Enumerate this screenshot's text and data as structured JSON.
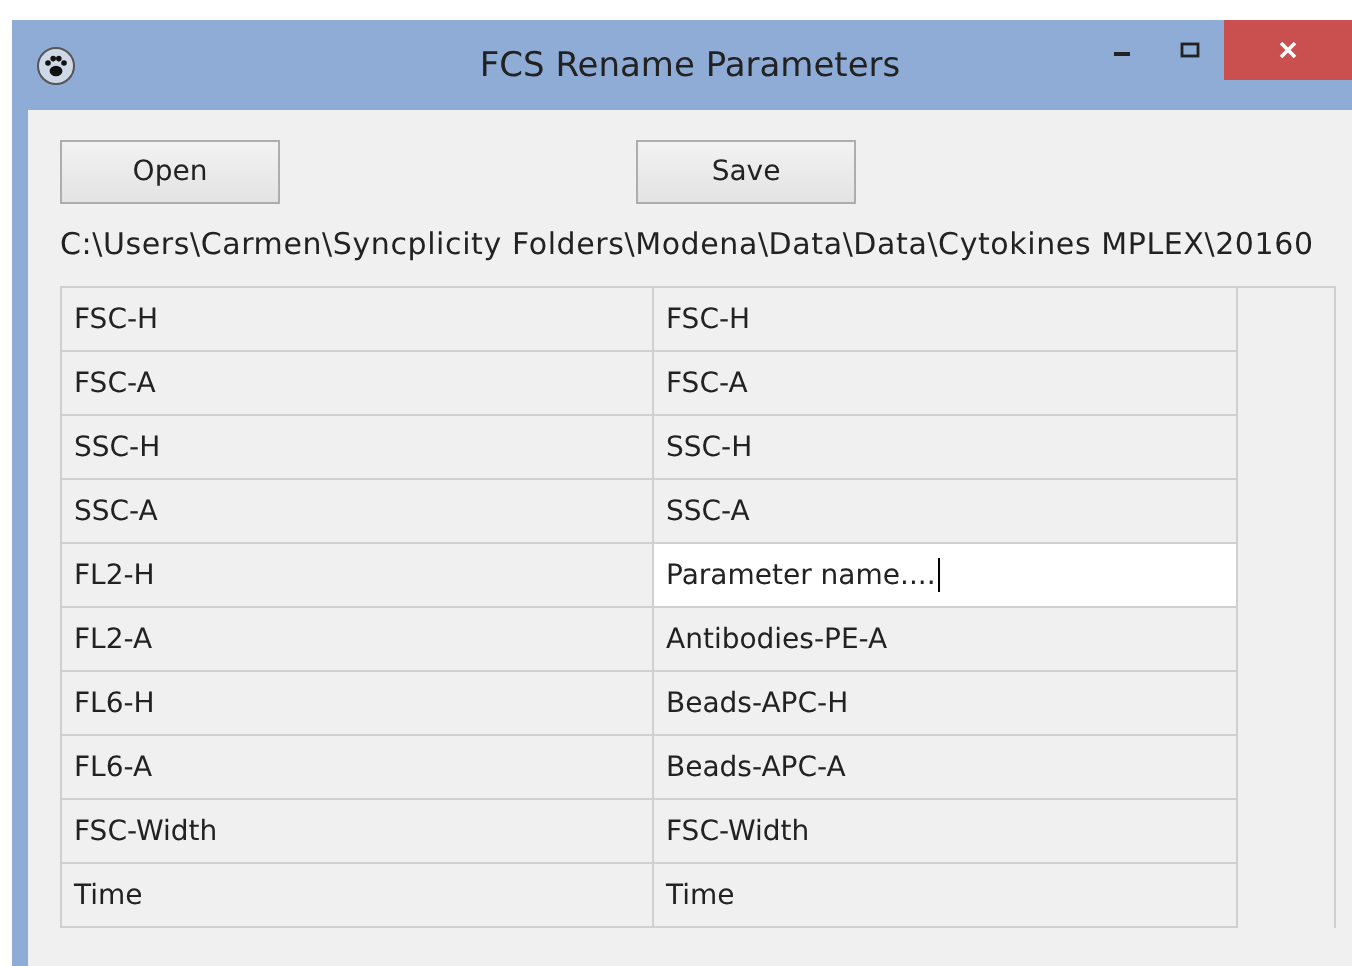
{
  "window": {
    "title": "FCS Rename Parameters"
  },
  "buttons": [
    "Open",
    "Save"
  ],
  "path": "C:\\Users\\Carmen\\Syncplicity Folders\\Modena\\Data\\Data\\Cytokines MPLEX\\20160",
  "rows": [
    {
      "name": "FSC-H",
      "value": "FSC-H",
      "editing": false
    },
    {
      "name": "FSC-A",
      "value": "FSC-A",
      "editing": false
    },
    {
      "name": "SSC-H",
      "value": "SSC-H",
      "editing": false
    },
    {
      "name": "SSC-A",
      "value": "SSC-A",
      "editing": false
    },
    {
      "name": "FL2-H",
      "value": "Parameter name....",
      "editing": true
    },
    {
      "name": "FL2-A",
      "value": "Antibodies-PE-A",
      "editing": false
    },
    {
      "name": "FL6-H",
      "value": "Beads-APC-H",
      "editing": false
    },
    {
      "name": "FL6-A",
      "value": "Beads-APC-A",
      "editing": false
    },
    {
      "name": "FSC-Width",
      "value": "FSC-Width",
      "editing": false
    },
    {
      "name": "Time",
      "value": "Time",
      "editing": false
    }
  ]
}
